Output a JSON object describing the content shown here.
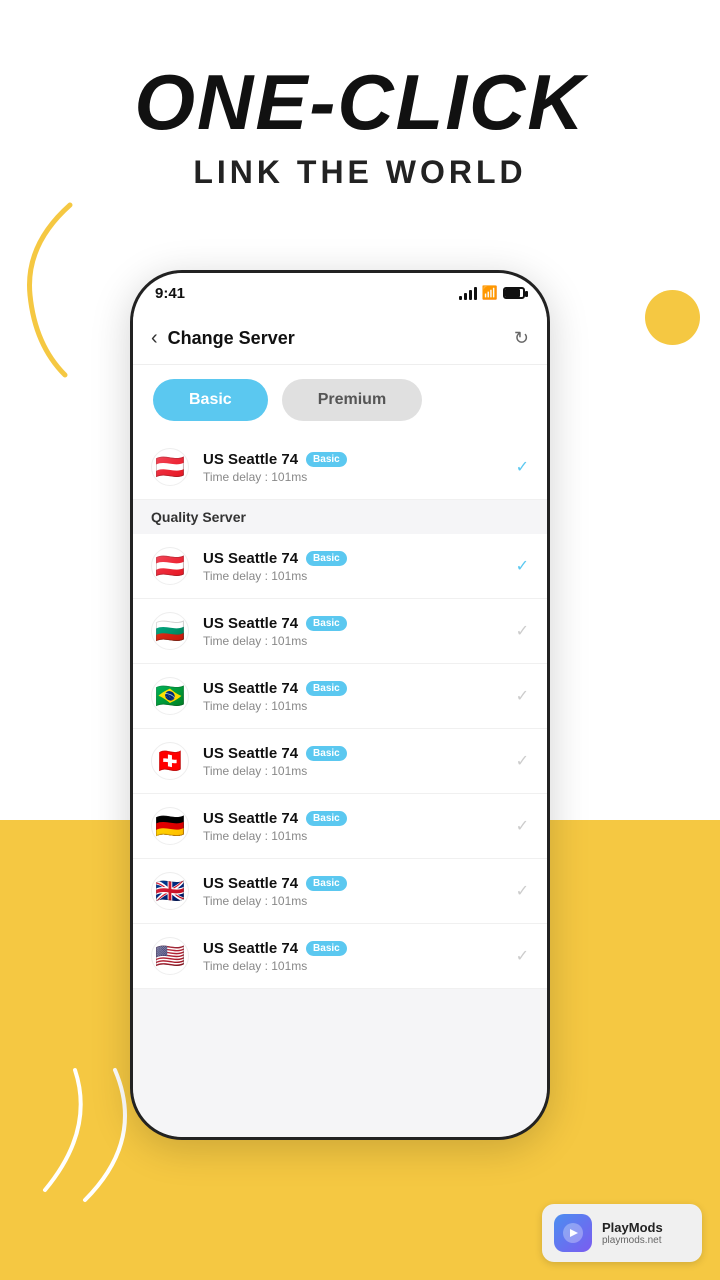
{
  "page": {
    "bg_top": "#ffffff",
    "bg_bottom": "#F5C842"
  },
  "header": {
    "main_title": "ONE-CLICK",
    "sub_title": "LINK THE WORLD"
  },
  "phone": {
    "status_bar": {
      "time": "9:41"
    },
    "app_header": {
      "back_label": "‹",
      "title": "Change Server",
      "refresh_label": "↻"
    },
    "tabs": [
      {
        "label": "Basic",
        "active": true
      },
      {
        "label": "Premium",
        "active": false
      }
    ],
    "top_server": {
      "flag": "🇦🇹",
      "name": "US Seattle 74",
      "badge": "Basic",
      "delay": "Time delay : 101ms",
      "selected": true
    },
    "section_header": "Quality Server",
    "servers": [
      {
        "flag": "🇦🇹",
        "name": "US Seattle 74",
        "badge": "Basic",
        "delay": "Time delay : 101ms",
        "selected": true
      },
      {
        "flag": "🇧🇬",
        "name": "US Seattle 74",
        "badge": "Basic",
        "delay": "Time delay : 101ms",
        "selected": false
      },
      {
        "flag": "🇧🇷",
        "name": "US Seattle 74",
        "badge": "Basic",
        "delay": "Time delay : 101ms",
        "selected": false
      },
      {
        "flag": "🇨🇭",
        "name": "US Seattle 74",
        "badge": "Basic",
        "delay": "Time delay : 101ms",
        "selected": false
      },
      {
        "flag": "🇩🇪",
        "name": "US Seattle 74",
        "badge": "Basic",
        "delay": "Time delay : 101ms",
        "selected": false
      },
      {
        "flag": "🇬🇧",
        "name": "US Seattle 74",
        "badge": "Basic",
        "delay": "Time delay : 101ms",
        "selected": false
      },
      {
        "flag": "🇺🇸",
        "name": "US Seattle 74",
        "badge": "Basic",
        "delay": "Time delay : 101ms",
        "selected": false
      }
    ]
  },
  "playmods": {
    "title": "PlayMods",
    "url": "playmods.net",
    "icon": "🎮"
  }
}
